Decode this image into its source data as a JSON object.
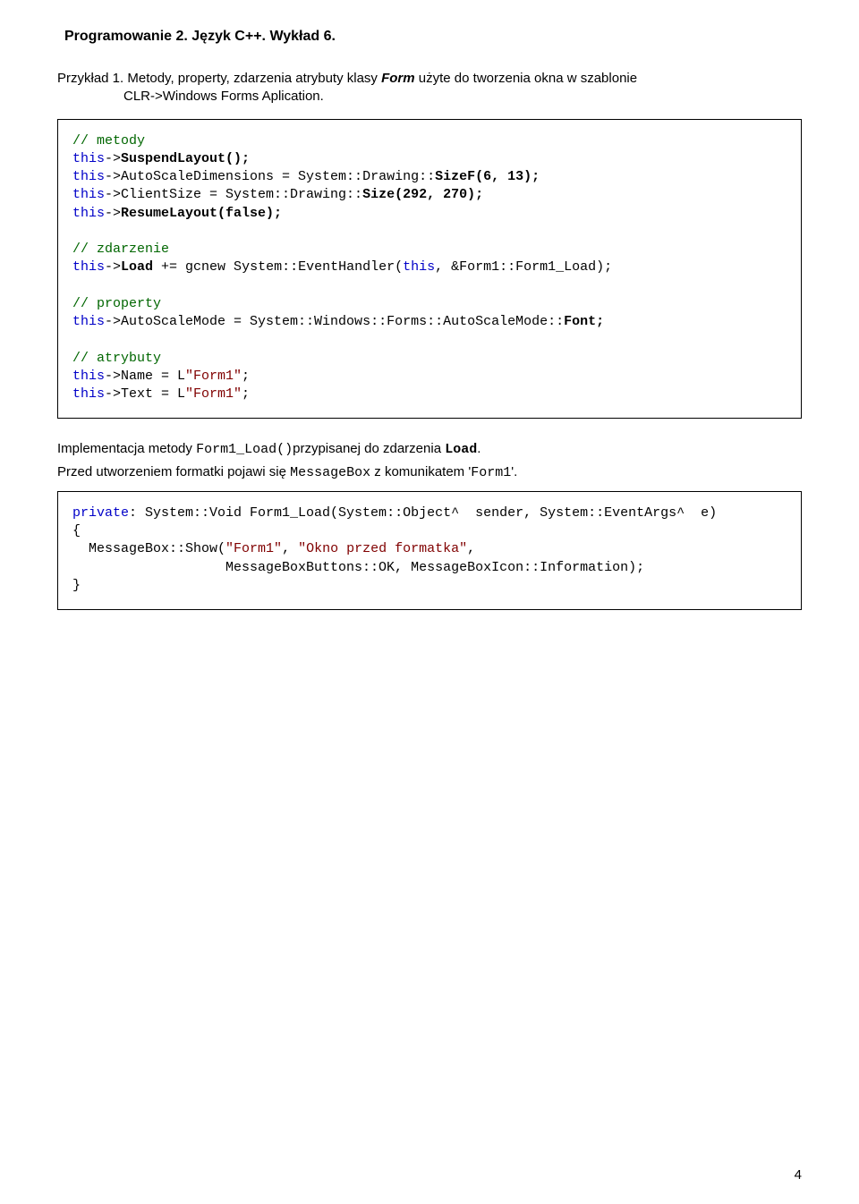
{
  "header": "Programowanie 2. Język C++. Wykład 6.",
  "intro": {
    "prefix": "Przykład 1. Metody, property, zdarzenia atrybuty klasy ",
    "form": "Form",
    "suffix": " użyte do tworzenia okna w szablonie",
    "line2": "CLR->Windows Forms Aplication."
  },
  "code1": {
    "c_metody": "// metody",
    "l1a": "this",
    "l1b": "->",
    "l1c": "SuspendLayout();",
    "l2a": "this",
    "l2b": "->AutoScaleDimensions = System::Drawing::",
    "l2c": "SizeF(6, 13);",
    "l3a": "this",
    "l3b": "->ClientSize = System::Drawing::",
    "l3c": "Size(292, 270);",
    "l4a": "this",
    "l4b": "->",
    "l4c": "ResumeLayout(false);",
    "c_zdarzenie": "// zdarzenie",
    "l5a": "this",
    "l5b": "->",
    "l5c": "Load",
    "l5d": " += gcnew System::EventHandler(",
    "l5e": "this",
    "l5f": ", &Form1::Form1_Load);",
    "c_property": "// property",
    "l6a": "this",
    "l6b": "->AutoScaleMode = System::Windows::Forms::AutoScaleMode::",
    "l6c": "Font;",
    "c_atrybuty": "// atrybuty",
    "l7a": "this",
    "l7b": "->Name = L",
    "l7c": "\"Form1\"",
    "l7d": ";",
    "l8a": "this",
    "l8b": "->Text = L",
    "l8c": "\"Form1\"",
    "l8d": ";"
  },
  "para1": {
    "p1": "Implementacja metody ",
    "p2": "Form1_Load()",
    "p3": "przypisanej do zdarzenia ",
    "p4": "Load",
    "p5": "."
  },
  "para2": {
    "p1": "Przed utworzeniem formatki pojawi się ",
    "p2": "MessageBox",
    "p3": " z komunikatem '",
    "p4": "Form1",
    "p5": "'."
  },
  "code2": {
    "l1a": "private",
    "l1b": ": System::Void Form1_Load(System::Object^  sender, System::EventArgs^  e)",
    "l2": "{",
    "l3a": "  MessageBox::Show(",
    "l3b": "\"Form1\"",
    "l3c": ", ",
    "l3d": "\"Okno przed formatka\"",
    "l3e": ",",
    "l4": "                   MessageBoxButtons::OK, MessageBoxIcon::Information);",
    "l5": "}"
  },
  "pageNum": "4"
}
